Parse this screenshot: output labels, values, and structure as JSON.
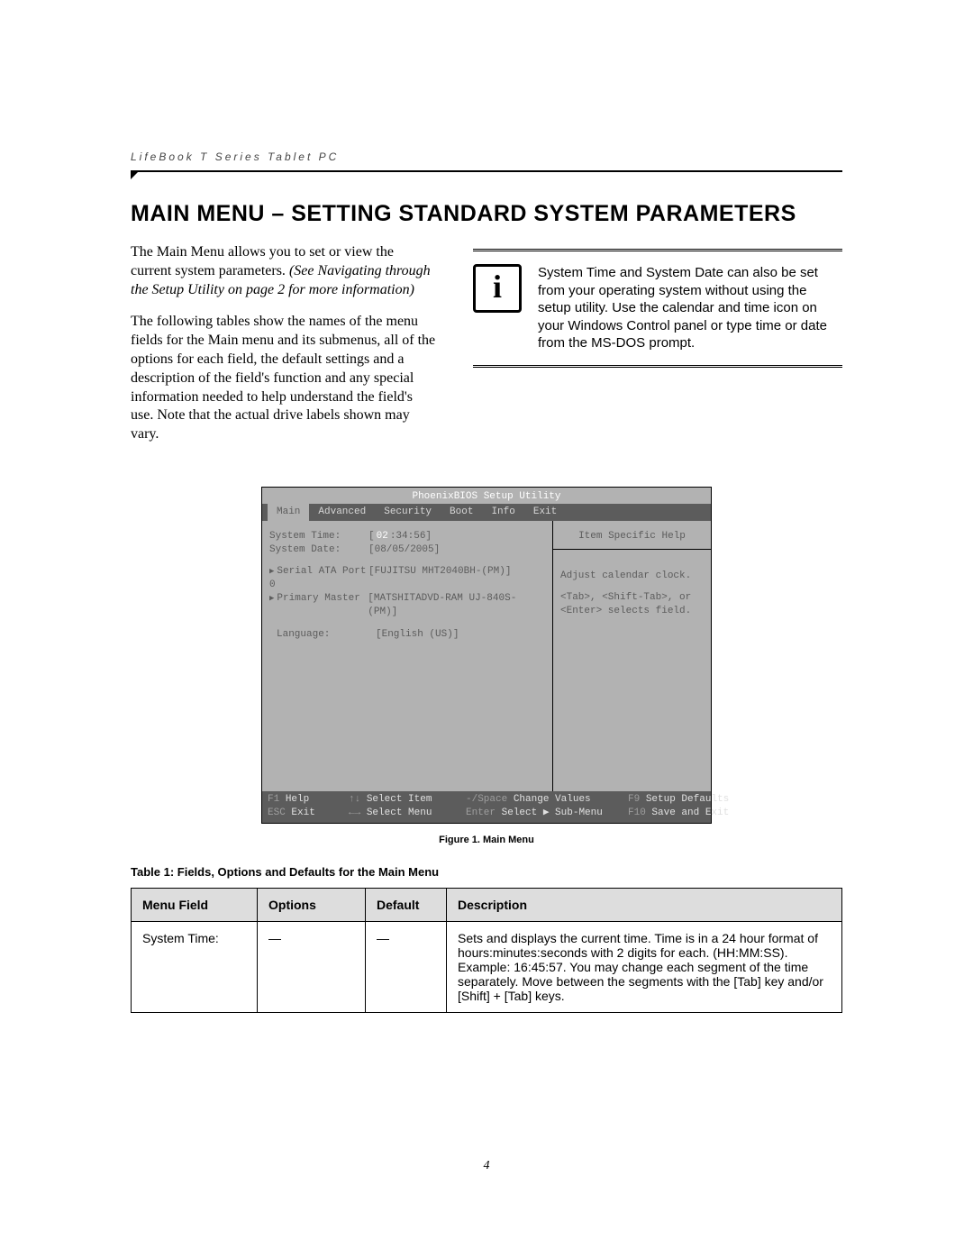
{
  "header": "LifeBook T Series Tablet PC",
  "title": "MAIN MENU – SETTING STANDARD SYSTEM PARAMETERS",
  "intro": {
    "p1a": "The Main Menu allows you to set or view the current system parameters. ",
    "p1b": "(See Navigating through the Setup Utility on page 2 for more information)",
    "p2": "The following tables show the names of the menu fields for the Main menu and its submenus, all of the options for each field, the default settings and a description of the field's function and any special information needed to help understand the field's use. Note that the actual drive labels shown may vary."
  },
  "info_box": "System Time and System Date can also be set from your operating system without using the setup utility. Use the calendar and time icon on your Windows Control panel or type time or date from the MS-DOS prompt.",
  "bios": {
    "title": "PhoenixBIOS Setup Utility",
    "tabs": {
      "main": "Main",
      "advanced": "Advanced",
      "security": "Security",
      "boot": "Boot",
      "info": "Info",
      "exit": "Exit"
    },
    "fields": {
      "system_time_label": "System Time:",
      "system_time_hour": "02",
      "system_time_rest": ":34:56]",
      "system_date_label": "System Date:",
      "system_date_value": "[08/05/2005]",
      "sata_label": "Serial ATA Port 0",
      "sata_value": "[FUJITSU MHT2040BH-(PM)]",
      "primary_label": "Primary Master",
      "primary_value": "[MATSHITADVD-RAM UJ-840S-(PM)]",
      "lang_label": "Language:",
      "lang_value": "[English (US)]"
    },
    "help": {
      "title": "Item Specific Help",
      "l1": "Adjust calendar clock.",
      "l2": "<Tab>, <Shift-Tab>, or",
      "l3": "<Enter> selects field."
    },
    "footer": {
      "f1k": "F1",
      "f1t": "Help",
      "esck": "ESC",
      "esct": "Exit",
      "si_k": "↑↓",
      "si_t": "Select Item",
      "sm_k": "←→",
      "sm_t": "Select Menu",
      "cv_k": "-/Space",
      "cv_t": "Change Values",
      "en_k": "Enter",
      "en_t": "Select ▶ Sub-Menu",
      "f9k": "F9",
      "f9t": "Setup Defaults",
      "f10k": "F10",
      "f10t": "Save and Exit"
    }
  },
  "figure_caption": "Figure 1.   Main Menu",
  "table_title": "Table 1: Fields, Options and Defaults for the Main Menu",
  "table": {
    "headers": {
      "field": "Menu Field",
      "options": "Options",
      "default": "Default",
      "desc": "Description"
    },
    "row1": {
      "field": "System Time:",
      "options": "—",
      "default": "—",
      "desc": "Sets and displays the current time. Time is in a 24 hour format of hours:minutes:seconds with 2 digits for each. (HH:MM:SS). Example: 16:45:57. You may change each segment of the time separately. Move between the segments with the [Tab] key and/or [Shift] + [Tab] keys."
    }
  },
  "page_number": "4"
}
